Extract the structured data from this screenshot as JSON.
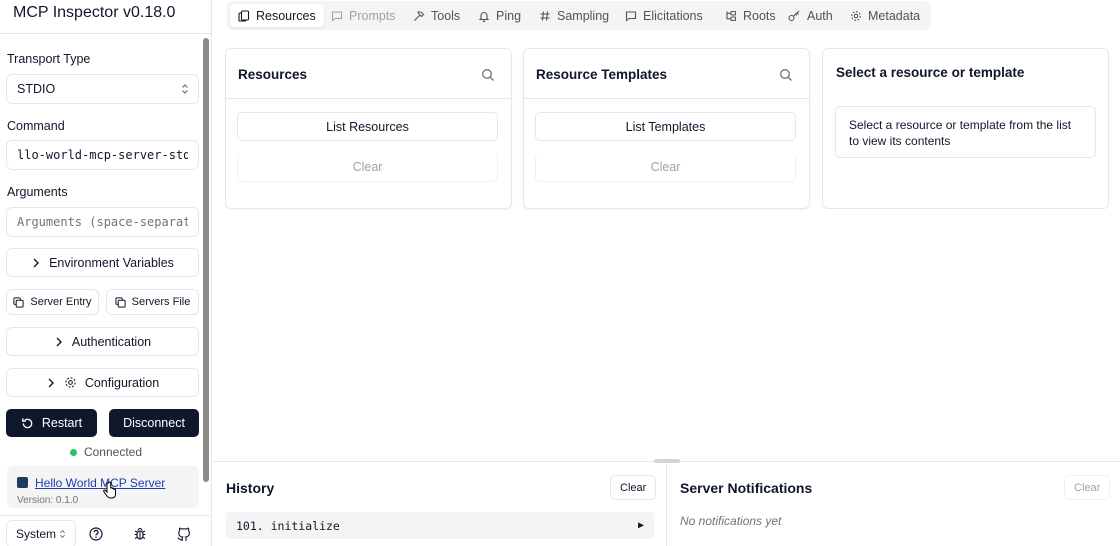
{
  "app": {
    "title": "MCP Inspector v0.18.0"
  },
  "sidebar": {
    "transport_label": "Transport Type",
    "transport_value": "STDIO",
    "command_label": "Command",
    "command_value": "llo-world-mcp-server-stdio",
    "arguments_label": "Arguments",
    "arguments_placeholder": "Arguments (space-separated)",
    "env_vars": "Environment Variables",
    "server_entry": "Server Entry",
    "servers_file": "Servers File",
    "authentication": "Authentication",
    "configuration": "Configuration",
    "restart": "Restart",
    "disconnect": "Disconnect",
    "status": "Connected",
    "status_color": "#22c55e",
    "server_name": "Hello World MCP Server",
    "server_version": "Version: 0.1.0",
    "theme": "System"
  },
  "tabs": [
    {
      "label": "Resources",
      "icon": "files-icon",
      "state": "active"
    },
    {
      "label": "Prompts",
      "icon": "message-square-icon",
      "state": "disabled"
    },
    {
      "label": "Tools",
      "icon": "hammer-icon",
      "state": "normal"
    },
    {
      "label": "Ping",
      "icon": "bell-icon",
      "state": "normal"
    },
    {
      "label": "Sampling",
      "icon": "hash-icon",
      "state": "normal"
    },
    {
      "label": "Elicitations",
      "icon": "message-square-icon",
      "state": "normal"
    },
    {
      "label": "Roots",
      "icon": "folder-tree-icon",
      "state": "normal"
    },
    {
      "label": "Auth",
      "icon": "key-icon",
      "state": "normal"
    },
    {
      "label": "Metadata",
      "icon": "settings-icon",
      "state": "normal"
    }
  ],
  "resources": {
    "title": "Resources",
    "list_button": "List Resources",
    "clear_button": "Clear"
  },
  "templates": {
    "title": "Resource Templates",
    "list_button": "List Templates",
    "clear_button": "Clear"
  },
  "detail": {
    "title": "Select a resource or template",
    "message": "Select a resource or template from the list to view its contents"
  },
  "history": {
    "title": "History",
    "clear_button": "Clear",
    "items": [
      {
        "label": "101. initialize",
        "expand": "▶"
      }
    ]
  },
  "notifications": {
    "title": "Server Notifications",
    "clear_button": "Clear",
    "empty": "No notifications yet"
  }
}
